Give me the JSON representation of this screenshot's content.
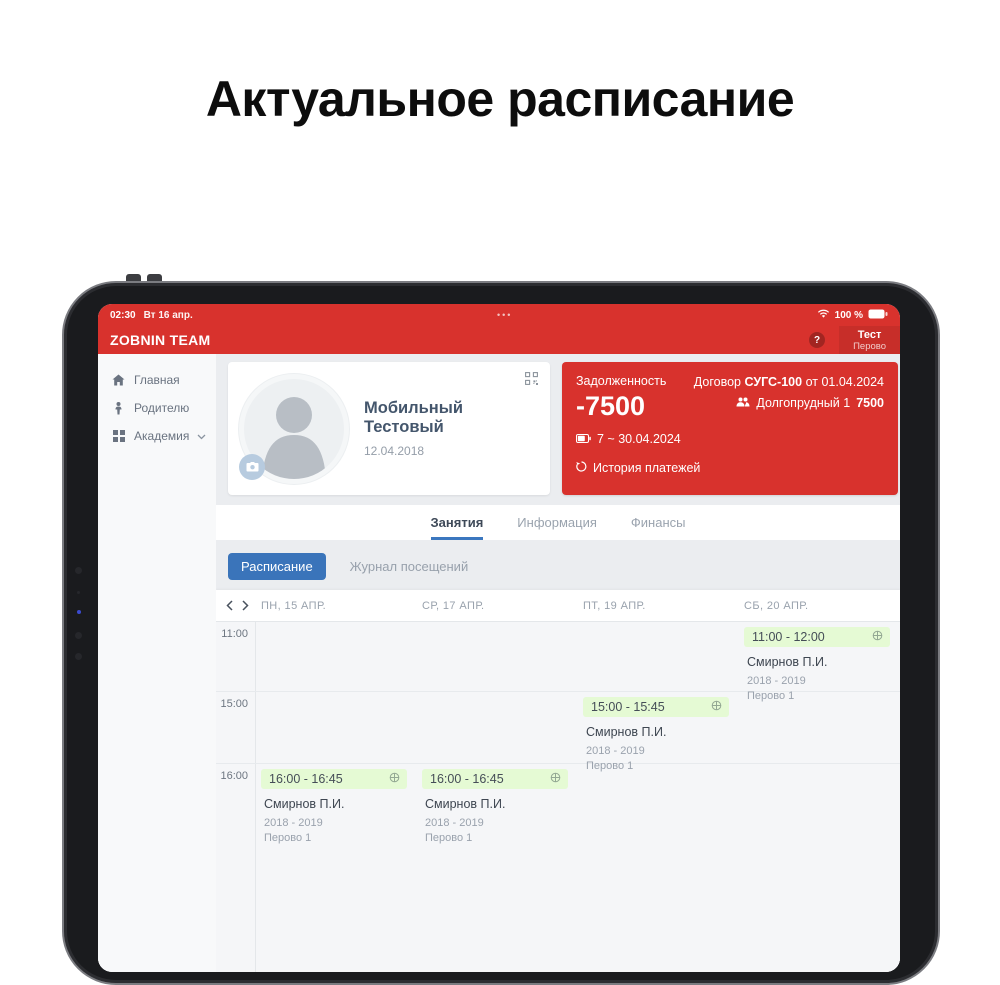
{
  "page": {
    "title": "Актуальное расписание"
  },
  "colors": {
    "primary_red": "#d8322d",
    "accent_blue": "#3a74ba",
    "event_green": "#e5fad4"
  },
  "status_bar": {
    "time": "02:30",
    "date": "Вт 16 апр.",
    "dots": "•••",
    "battery": "100 %"
  },
  "app_bar": {
    "brand": "ZOBNIN TEAM",
    "help": "?",
    "user": {
      "name": "Тест",
      "branch": "Перово"
    }
  },
  "sidebar": {
    "items": [
      {
        "label": "Главная"
      },
      {
        "label": "Родителю"
      },
      {
        "label": "Академия"
      }
    ]
  },
  "profile": {
    "name": "Мобильный Тестовый",
    "birthdate": "12.04.2018"
  },
  "debt": {
    "label": "Задолженность",
    "amount": "-7500",
    "period": "7 ~ 30.04.2024",
    "history": "История платежей",
    "contract_label": "Договор",
    "contract_number": "СУГС-100",
    "contract_from": "от 01.04.2024",
    "branch": "Долгопрудный 1",
    "branch_amount": "7500"
  },
  "tabs": [
    {
      "label": "Занятия",
      "active": true
    },
    {
      "label": "Информация",
      "active": false
    },
    {
      "label": "Финансы",
      "active": false
    }
  ],
  "subnav": {
    "schedule_btn": "Расписание",
    "journal_btn": "Журнал посещений"
  },
  "schedule": {
    "days": [
      "ПН, 15 АПР.",
      "СР, 17 АПР.",
      "ПТ, 19 АПР.",
      "СБ, 20 АПР."
    ],
    "rows": [
      {
        "time": "11:00",
        "events": [
          null,
          null,
          null,
          {
            "time": "11:00 - 12:00",
            "coach": "Смирнов П.И.",
            "group": "2018 - 2019",
            "place": "Перово 1"
          }
        ]
      },
      {
        "time": "15:00",
        "events": [
          null,
          null,
          {
            "time": "15:00 - 15:45",
            "coach": "Смирнов П.И.",
            "group": "2018 - 2019",
            "place": "Перово 1"
          },
          null
        ]
      },
      {
        "time": "16:00",
        "events": [
          {
            "time": "16:00 - 16:45",
            "coach": "Смирнов П.И.",
            "group": "2018 - 2019",
            "place": "Перово 1"
          },
          {
            "time": "16:00 - 16:45",
            "coach": "Смирнов П.И.",
            "group": "2018 - 2019",
            "place": "Перово 1"
          },
          null,
          null
        ]
      }
    ]
  }
}
